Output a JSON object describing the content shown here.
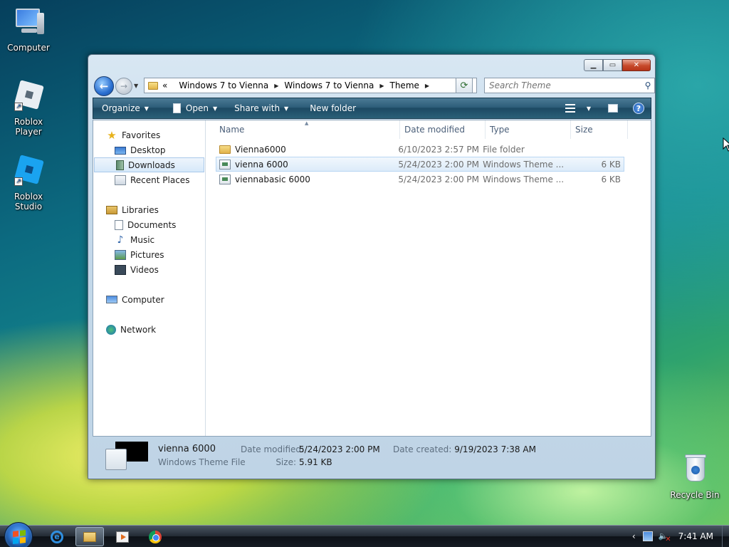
{
  "desktop": {
    "icons": [
      {
        "label": "Computer"
      },
      {
        "label": "Roblox Player"
      },
      {
        "label": "Roblox Studio"
      },
      {
        "label": "Recycle Bin"
      }
    ]
  },
  "window": {
    "address": {
      "overflow": "«",
      "crumbs": [
        "Windows 7 to Vienna",
        "Windows 7 to Vienna",
        "Theme"
      ]
    },
    "search_placeholder": "Search Theme",
    "toolbar": {
      "organize": "Organize",
      "open": "Open",
      "share_with": "Share with",
      "new_folder": "New folder"
    },
    "nav": {
      "favorites": "Favorites",
      "favorite_items": [
        "Desktop",
        "Downloads",
        "Recent Places"
      ],
      "libraries": "Libraries",
      "library_items": [
        "Documents",
        "Music",
        "Pictures",
        "Videos"
      ],
      "computer": "Computer",
      "network": "Network"
    },
    "columns": {
      "name": "Name",
      "date": "Date modified",
      "type": "Type",
      "size": "Size"
    },
    "files": [
      {
        "name": "Vienna6000",
        "date": "6/10/2023 2:57 PM",
        "type": "File folder",
        "size": "",
        "kind": "folder"
      },
      {
        "name": "vienna 6000",
        "date": "5/24/2023 2:00 PM",
        "type": "Windows Theme ...",
        "size": "6 KB",
        "kind": "theme"
      },
      {
        "name": "viennabasic 6000",
        "date": "5/24/2023 2:00 PM",
        "type": "Windows Theme ...",
        "size": "6 KB",
        "kind": "theme"
      }
    ],
    "details": {
      "name": "vienna 6000",
      "type": "Windows Theme File",
      "date_modified_label": "Date modified:",
      "date_modified": "5/24/2023 2:00 PM",
      "size_label": "Size:",
      "size": "5.91 KB",
      "date_created_label": "Date created:",
      "date_created": "9/19/2023 7:38 AM"
    }
  },
  "taskbar": {
    "clock": "7:41 AM"
  }
}
